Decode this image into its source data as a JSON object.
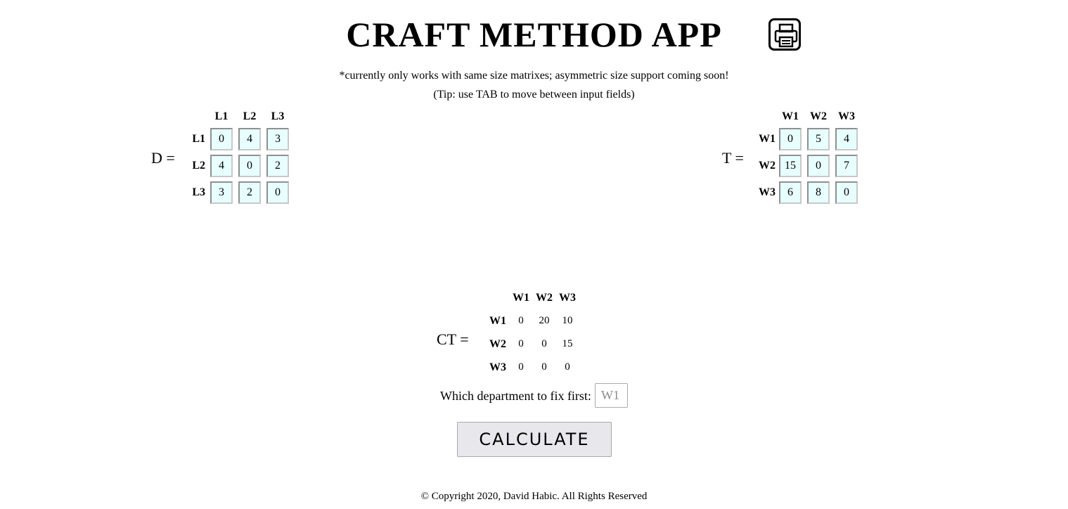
{
  "header": {
    "title": "CRAFT METHOD APP",
    "print_icon": "printer-icon"
  },
  "notes": {
    "size_note": "*currently only works with same size matrixes; asymmetric size support coming soon!",
    "tip": "(Tip: use TAB to move between input fields)"
  },
  "matrix_d": {
    "label": "D =",
    "columns": [
      "L1",
      "L2",
      "L3"
    ],
    "rows": [
      "L1",
      "L2",
      "L3"
    ],
    "values": [
      [
        "0",
        "4",
        "3"
      ],
      [
        "4",
        "0",
        "2"
      ],
      [
        "3",
        "2",
        "0"
      ]
    ]
  },
  "matrix_t": {
    "label": "T =",
    "columns": [
      "W1",
      "W2",
      "W3"
    ],
    "rows": [
      "W1",
      "W2",
      "W3"
    ],
    "values": [
      [
        "0",
        "5",
        "4"
      ],
      [
        "15",
        "0",
        "7"
      ],
      [
        "6",
        "8",
        "0"
      ]
    ]
  },
  "matrix_ct": {
    "label": "CT =",
    "columns": [
      "W1",
      "W2",
      "W3"
    ],
    "rows": [
      "W1",
      "W2",
      "W3"
    ],
    "values": [
      [
        "0",
        "20",
        "10"
      ],
      [
        "0",
        "0",
        "15"
      ],
      [
        "0",
        "0",
        "0"
      ]
    ]
  },
  "fix_first": {
    "label": "Which department to fix first:",
    "placeholder": "W1"
  },
  "calculate_label": "CALCULATE",
  "footer": "© Copyright 2020, David Habic. All Rights Reserved"
}
